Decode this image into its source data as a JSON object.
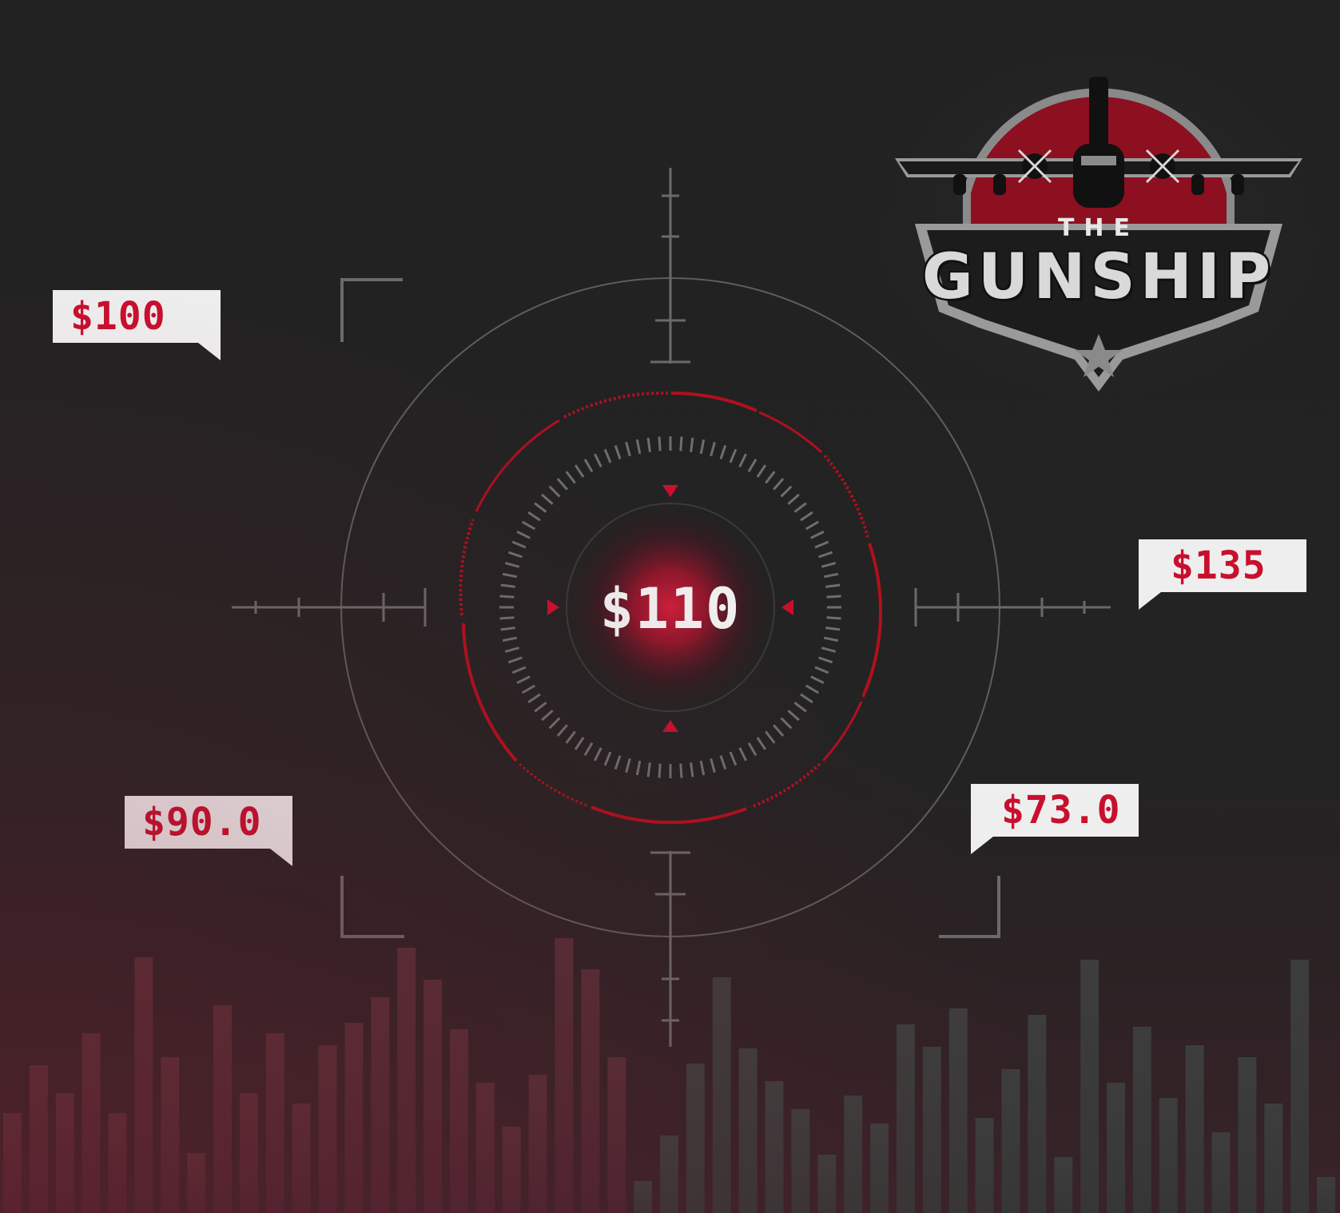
{
  "reticle": {
    "center_price": "$110"
  },
  "price_tags": [
    {
      "id": "tag-100",
      "label": "$100"
    },
    {
      "id": "tag-135",
      "label": "$135"
    },
    {
      "id": "tag-90",
      "label": "$90.0"
    },
    {
      "id": "tag-73",
      "label": "$73.0"
    }
  ],
  "logo": {
    "the": "THE",
    "wordmark": "GUNSHIP"
  },
  "colors": {
    "accent_red": "#c8102e",
    "reticle_red": "#b0101f",
    "reticle_gray": "#6a6a6a",
    "background": "#222222",
    "tag_background": "#eeeeee"
  },
  "icons": [
    "crosshair-icon",
    "gunship-plane-icon",
    "star-icon",
    "triangle-marker-icon"
  ]
}
